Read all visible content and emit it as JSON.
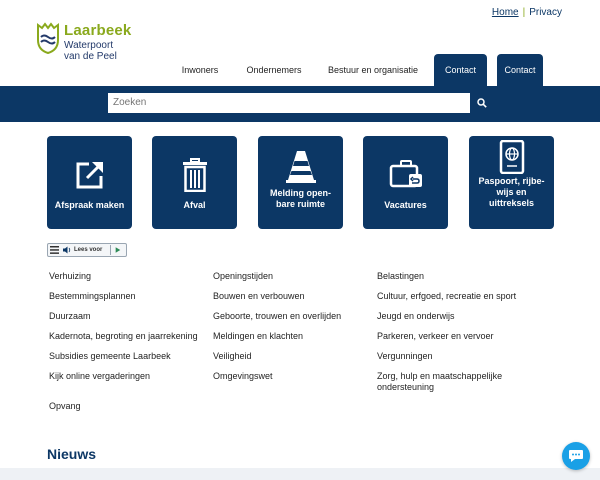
{
  "logo": {
    "name": "Laarbeek",
    "sub_line1": "Waterpoort",
    "sub_line2": "van de Peel"
  },
  "top_links": {
    "home": "Home",
    "privacy": "Privacy"
  },
  "nav": {
    "items": [
      {
        "label": "Inwoners",
        "active": false
      },
      {
        "label": "Ondernemers",
        "active": false
      },
      {
        "label": "Bestuur en organisatie",
        "active": false
      },
      {
        "label": "Contact",
        "active": true
      },
      {
        "label": "Contact",
        "active": true
      }
    ]
  },
  "search": {
    "placeholder": "Zoeken"
  },
  "tiles": [
    {
      "label_lines": [
        "Afspraak maken"
      ],
      "icon": "external-link-icon"
    },
    {
      "label_lines": [
        "Afval"
      ],
      "icon": "trash-can-icon"
    },
    {
      "label_lines": [
        "Melding open-",
        "bare ruimte"
      ],
      "icon": "traffic-cone-icon"
    },
    {
      "label_lines": [
        "Vacatures"
      ],
      "icon": "briefcase-icon"
    },
    {
      "label_lines": [
        "Paspoort, rijbe-",
        "wijs en",
        "uittreksels"
      ],
      "icon": "passport-icon"
    }
  ],
  "reader": {
    "label": "Lees voor"
  },
  "links": {
    "col1": [
      "Verhuizing",
      "Bestemmingsplannen",
      "Duurzaam",
      "Kadernota, begroting en jaarrekening",
      "Subsidies gemeente Laarbeek",
      "Kijk online vergaderingen",
      "Opvang"
    ],
    "col2": [
      "Openingstijden",
      "Bouwen en verbouwen",
      "Geboorte, trouwen en overlijden",
      "Meldingen en klachten",
      "Veiligheid",
      "Omgevingswet"
    ],
    "col3": [
      "Belastingen",
      "Cultuur, erfgoed, recreatie en sport",
      "Jeugd en onderwijs",
      "Parkeren, verkeer en vervoer",
      "Vergunningen",
      "Zorg, hulp en maatschappelijke",
      "ondersteuning"
    ]
  },
  "news": {
    "title": "Nieuws"
  },
  "colors": {
    "primary": "#0c3765",
    "brand_green": "#8aa91d",
    "chat": "#1aa0e6"
  }
}
